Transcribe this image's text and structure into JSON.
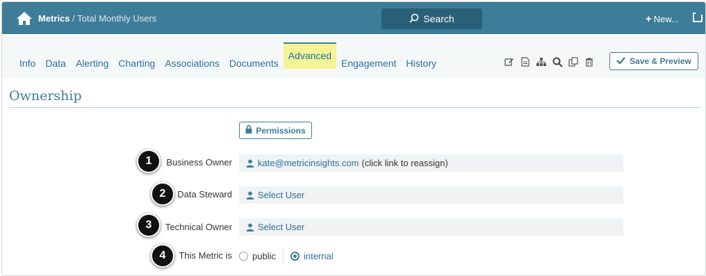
{
  "topbar": {
    "breadcrumb_root": "Metrics",
    "breadcrumb_sep": " / ",
    "breadcrumb_current": "Total Monthly Users",
    "search_label": "Search",
    "new_label": "New...",
    "bg_color": "#3d7d99"
  },
  "tabs": [
    {
      "label": "Info"
    },
    {
      "label": "Data"
    },
    {
      "label": "Alerting"
    },
    {
      "label": "Charting"
    },
    {
      "label": "Associations"
    },
    {
      "label": "Documents"
    },
    {
      "label": "Advanced",
      "active": true
    },
    {
      "label": "Engagement"
    },
    {
      "label": "History"
    }
  ],
  "toolbar": {
    "icons": [
      "edit-icon",
      "document-icon",
      "hierarchy-icon",
      "search-icon",
      "copy-icon",
      "trash-icon"
    ],
    "save_label": "Save & Preview"
  },
  "section": {
    "title": "Ownership",
    "permissions_label": "Permissions"
  },
  "fields": {
    "business_owner": {
      "badge": "1",
      "label": "Business Owner",
      "value": "kate@metricinsights.com",
      "note": "(click link to reassign)"
    },
    "data_steward": {
      "badge": "2",
      "label": "Data Steward",
      "value": "Select User"
    },
    "technical_owner": {
      "badge": "3",
      "label": "Technical Owner",
      "value": "Select User"
    },
    "visibility": {
      "badge": "4",
      "label": "This Metric is",
      "options": [
        {
          "label": "public",
          "selected": false
        },
        {
          "label": "internal",
          "selected": true
        }
      ]
    }
  },
  "colors": {
    "accent": "#3d7d99",
    "link": "#2a6fa1",
    "active_tab_bg": "#f3f396"
  }
}
